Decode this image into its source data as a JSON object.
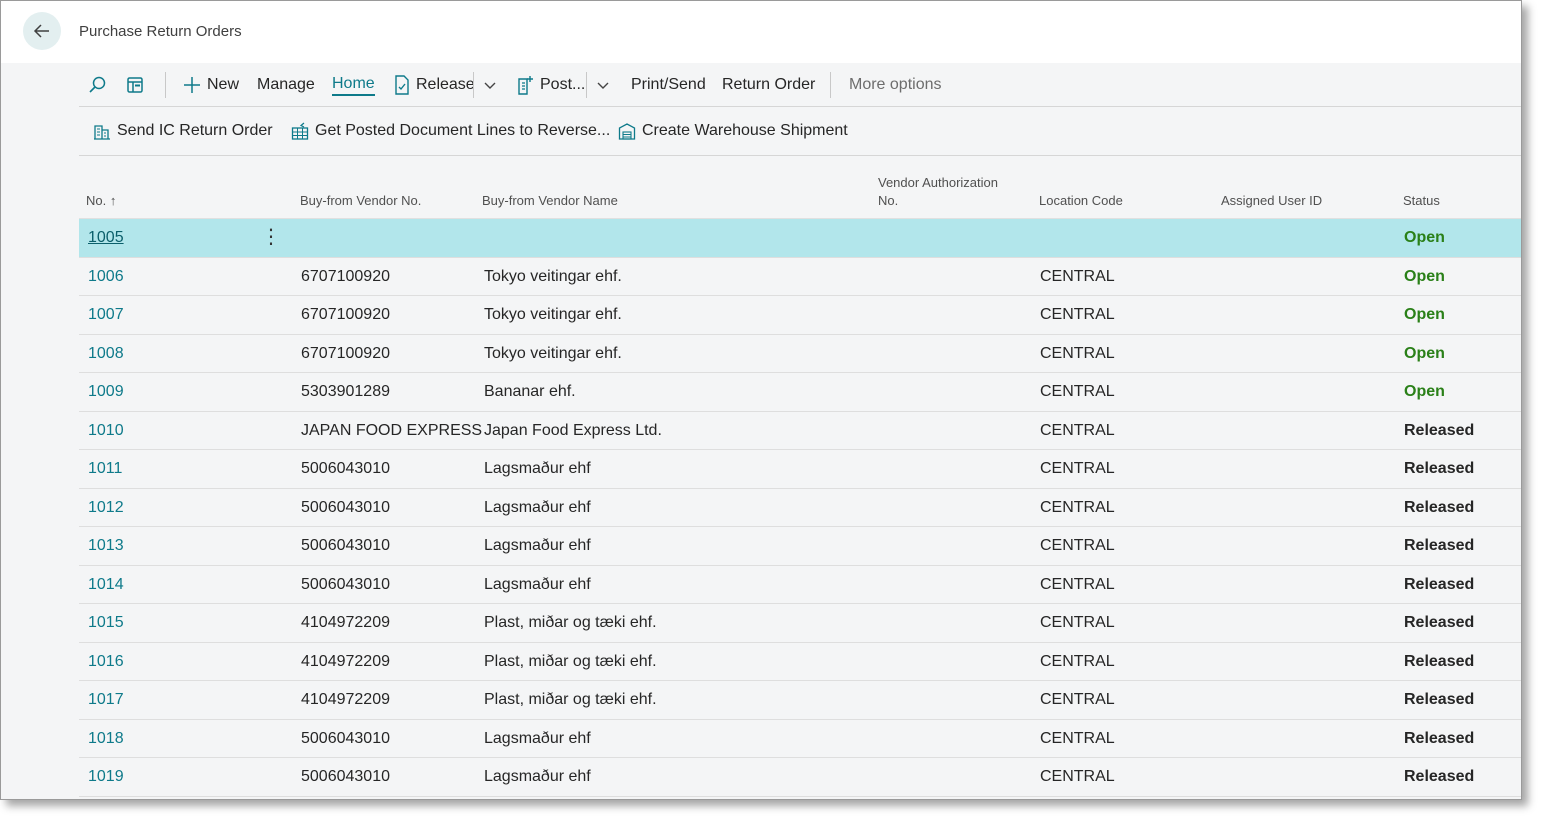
{
  "page": {
    "title": "Purchase Return Orders"
  },
  "actions": {
    "new": "New",
    "manage": "Manage",
    "home": "Home",
    "release": "Release",
    "post": "Post...",
    "print_send": "Print/Send",
    "return_order": "Return Order",
    "more_options": "More options"
  },
  "promoted": {
    "send_ic": "Send IC Return Order",
    "get_posted": "Get Posted Document Lines to Reverse...",
    "create_ws": "Create Warehouse Shipment"
  },
  "columns": {
    "no": "No. ↑",
    "vendor_no": "Buy-from Vendor No.",
    "vendor_name": "Buy-from Vendor Name",
    "vendor_auth_1": "Vendor Authorization",
    "vendor_auth_2": "No.",
    "location": "Location Code",
    "assigned": "Assigned User ID",
    "status": "Status"
  },
  "rows": [
    {
      "no": "1005",
      "vendor_no": "",
      "vendor_name": "",
      "location": "",
      "status": "Open"
    },
    {
      "no": "1006",
      "vendor_no": "6707100920",
      "vendor_name": "Tokyo veitingar ehf.",
      "location": "CENTRAL",
      "status": "Open"
    },
    {
      "no": "1007",
      "vendor_no": "6707100920",
      "vendor_name": "Tokyo veitingar ehf.",
      "location": "CENTRAL",
      "status": "Open"
    },
    {
      "no": "1008",
      "vendor_no": "6707100920",
      "vendor_name": "Tokyo veitingar ehf.",
      "location": "CENTRAL",
      "status": "Open"
    },
    {
      "no": "1009",
      "vendor_no": "5303901289",
      "vendor_name": "Bananar ehf.",
      "location": "CENTRAL",
      "status": "Open"
    },
    {
      "no": "1010",
      "vendor_no": "JAPAN FOOD EXPRESS",
      "vendor_name": "Japan Food Express Ltd.",
      "location": "CENTRAL",
      "status": "Released"
    },
    {
      "no": "1011",
      "vendor_no": "5006043010",
      "vendor_name": "Lagsmaður ehf",
      "location": "CENTRAL",
      "status": "Released"
    },
    {
      "no": "1012",
      "vendor_no": "5006043010",
      "vendor_name": "Lagsmaður ehf",
      "location": "CENTRAL",
      "status": "Released"
    },
    {
      "no": "1013",
      "vendor_no": "5006043010",
      "vendor_name": "Lagsmaður ehf",
      "location": "CENTRAL",
      "status": "Released"
    },
    {
      "no": "1014",
      "vendor_no": "5006043010",
      "vendor_name": "Lagsmaður ehf",
      "location": "CENTRAL",
      "status": "Released"
    },
    {
      "no": "1015",
      "vendor_no": "4104972209",
      "vendor_name": "Plast, miðar og tæki ehf.",
      "location": "CENTRAL",
      "status": "Released"
    },
    {
      "no": "1016",
      "vendor_no": "4104972209",
      "vendor_name": "Plast, miðar og tæki ehf.",
      "location": "CENTRAL",
      "status": "Released"
    },
    {
      "no": "1017",
      "vendor_no": "4104972209",
      "vendor_name": "Plast, miðar og tæki ehf.",
      "location": "CENTRAL",
      "status": "Released"
    },
    {
      "no": "1018",
      "vendor_no": "5006043010",
      "vendor_name": "Lagsmaður ehf",
      "location": "CENTRAL",
      "status": "Released"
    },
    {
      "no": "1019",
      "vendor_no": "5006043010",
      "vendor_name": "Lagsmaður ehf",
      "location": "CENTRAL",
      "status": "Released"
    }
  ]
}
